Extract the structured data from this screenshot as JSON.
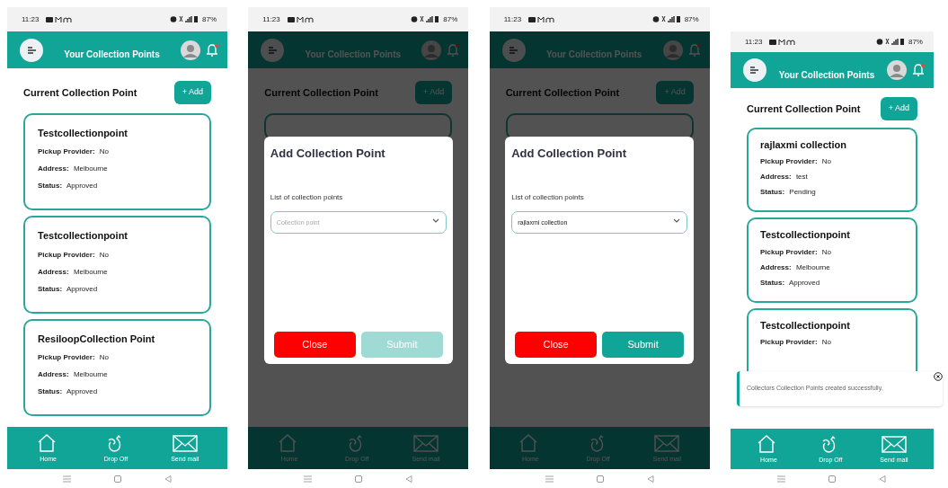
{
  "screens": [
    {
      "status_bar": {
        "time": "11:23",
        "battery": "87%"
      },
      "header": {
        "title": "Your Collection Points"
      },
      "section": {
        "heading": "Current Collection Point",
        "add_button": "+ Add"
      },
      "cards": [
        {
          "name": "Testcollectionpoint",
          "fields": [
            {
              "label": "Pickup Provider:",
              "value": "No"
            },
            {
              "label": "Address:",
              "value": "Melbourne"
            },
            {
              "label": "Status:",
              "value": "Approved"
            }
          ]
        },
        {
          "name": "Testcollectionpoint",
          "fields": [
            {
              "label": "Pickup Provider:",
              "value": "No"
            },
            {
              "label": "Address:",
              "value": "Melbourne"
            },
            {
              "label": "Status:",
              "value": "Approved"
            }
          ]
        },
        {
          "name": "ResiloopCollection Point",
          "fields": [
            {
              "label": "Pickup Provider:",
              "value": "No"
            },
            {
              "label": "Address:",
              "value": "Melbourne"
            },
            {
              "label": "Status:",
              "value": "Approved"
            }
          ]
        }
      ],
      "nav": [
        {
          "label": "Home",
          "kind": "home"
        },
        {
          "label": "Drop Off",
          "kind": "dropoff"
        },
        {
          "label": "Send mail",
          "kind": "mail"
        }
      ]
    },
    {
      "status_bar": {
        "time": "11:23",
        "battery": "87%"
      },
      "header": {
        "title": "Your Collection Points"
      },
      "section": {
        "heading": "Current Collection Point",
        "add_button": "+ Add"
      },
      "modal": {
        "title": "Add Collection Point",
        "field_label": "List of collection points",
        "select": {
          "placeholder": "Collection point"
        },
        "buttons": [
          {
            "label": "Close",
            "kind": "close",
            "disabled": false
          },
          {
            "label": "Submit",
            "kind": "submit",
            "disabled": true
          }
        ]
      },
      "nav": [
        {
          "label": "Home",
          "kind": "home"
        },
        {
          "label": "Drop Off",
          "kind": "dropoff"
        },
        {
          "label": "Send mail",
          "kind": "mail"
        }
      ]
    },
    {
      "status_bar": {
        "time": "11:23",
        "battery": "87%"
      },
      "header": {
        "title": "Your Collection Points"
      },
      "section": {
        "heading": "Current Collection Point",
        "add_button": "+ Add"
      },
      "modal": {
        "title": "Add Collection Point",
        "field_label": "List of collection points",
        "select": {
          "value": "rajlaxmi collection"
        },
        "buttons": [
          {
            "label": "Close",
            "kind": "close",
            "disabled": false
          },
          {
            "label": "Submit",
            "kind": "submit",
            "disabled": false
          }
        ]
      },
      "nav": [
        {
          "label": "Home",
          "kind": "home"
        },
        {
          "label": "Drop Off",
          "kind": "dropoff"
        },
        {
          "label": "Send mail",
          "kind": "mail"
        }
      ]
    },
    {
      "status_bar": {
        "time": "11:23",
        "battery": "87%"
      },
      "header": {
        "title": "Your Collection Points"
      },
      "section": {
        "heading": "Current Collection Point",
        "add_button": "+ Add"
      },
      "cards": [
        {
          "name": "rajlaxmi collection",
          "fields": [
            {
              "label": "Pickup Provider:",
              "value": "No"
            },
            {
              "label": "Address:",
              "value": "test"
            },
            {
              "label": "Status:",
              "value": "Pending"
            }
          ]
        },
        {
          "name": "Testcollectionpoint",
          "fields": [
            {
              "label": "Pickup Provider:",
              "value": "No"
            },
            {
              "label": "Address:",
              "value": "Melbourne"
            },
            {
              "label": "Status:",
              "value": "Approved"
            }
          ]
        },
        {
          "name": "Testcollectionpoint",
          "fields": [
            {
              "label": "Pickup Provider:",
              "value": "No"
            }
          ]
        }
      ],
      "toast": {
        "message": "Collectors Collection Points created successfully."
      },
      "nav": [
        {
          "label": "Home",
          "kind": "home"
        },
        {
          "label": "Drop Off",
          "kind": "dropoff"
        },
        {
          "label": "Send mail",
          "kind": "mail"
        }
      ]
    }
  ]
}
